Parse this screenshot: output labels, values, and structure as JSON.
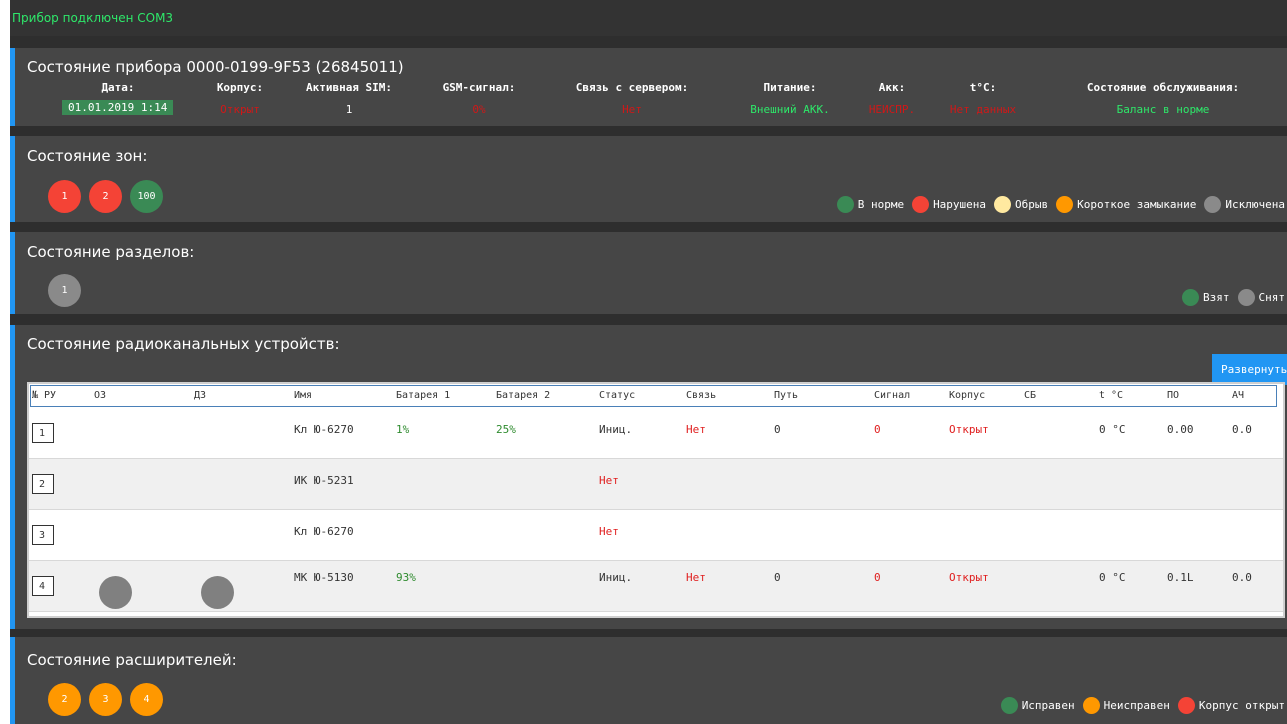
{
  "status_bar": {
    "text": "Прибор подключен COM3"
  },
  "device": {
    "title": "Состояние прибора 0000-0199-9F53 (26845011)",
    "fields": [
      {
        "label": "Дата:",
        "value": "01.01.2019 1:14",
        "color": "#ffffff",
        "boxed": true
      },
      {
        "label": "Корпус:",
        "value": "Открыт",
        "color": "#d01818"
      },
      {
        "label": "Активная SIM:",
        "value": "1",
        "color": "#ffffff"
      },
      {
        "label": "GSM-сигнал:",
        "value": "0%",
        "color": "#d01818"
      },
      {
        "label": "Связь с сервером:",
        "value": "Нет",
        "color": "#d01818"
      },
      {
        "label": "Питание:",
        "value": "Внешний АКК.",
        "color": "#2ee86a"
      },
      {
        "label": "Акк:",
        "value": "НЕИСПР.",
        "color": "#d01818"
      },
      {
        "label": "t°C:",
        "value": "Нет данных",
        "color": "#d01818"
      },
      {
        "label": "Состояние обслуживания:",
        "value": "Баланс в норме",
        "color": "#2ee86a"
      }
    ]
  },
  "zones": {
    "title": "Состояние зон:",
    "items": [
      {
        "label": "1",
        "state": "red"
      },
      {
        "label": "2",
        "state": "red"
      },
      {
        "label": "100",
        "state": "green"
      }
    ],
    "legend": [
      {
        "label": "В норме",
        "color": "#3a8a55"
      },
      {
        "label": "Нарушена",
        "color": "#f44336"
      },
      {
        "label": "Обрыв",
        "color": "#ffe9a0"
      },
      {
        "label": "Короткое замыкание",
        "color": "#ff9800"
      },
      {
        "label": "Исключена",
        "color": "#8a8a8a"
      }
    ]
  },
  "partitions": {
    "title": "Состояние разделов:",
    "items": [
      {
        "label": "1",
        "state": "grey"
      }
    ],
    "legend": [
      {
        "label": "Взят",
        "color": "#3a8a55"
      },
      {
        "label": "Снят",
        "color": "#8a8a8a"
      }
    ]
  },
  "radio": {
    "title": "Состояние радиоканальных устройств:",
    "expand_label": "Развернуть",
    "columns": [
      "№ РУ",
      "ОЗ",
      "ДЗ",
      "Имя",
      "Батарея 1",
      "Батарея 2",
      "Статус",
      "Связь",
      "Путь",
      "Сигнал",
      "Корпус",
      "СБ",
      "t °C",
      "ПО",
      "АЧ"
    ],
    "rows": [
      {
        "num": "1",
        "oz": false,
        "dz": false,
        "name": "Кл Ю-6270",
        "bat1": "1%",
        "bat2": "25%",
        "status": "Иниц.",
        "status_red": false,
        "link": "Нет",
        "path": "0",
        "signal": "0",
        "case": "Открыт",
        "sb": "",
        "temp": "0 °C",
        "fw": "0.00",
        "ach": "0.0"
      },
      {
        "num": "2",
        "oz": false,
        "dz": false,
        "name": "ИК Ю-5231",
        "bat1": "",
        "bat2": "",
        "status": "Нет",
        "status_red": true,
        "link": "",
        "path": "",
        "signal": "",
        "case": "",
        "sb": "",
        "temp": "",
        "fw": "",
        "ach": ""
      },
      {
        "num": "3",
        "oz": false,
        "dz": false,
        "name": "Кл Ю-6270",
        "bat1": "",
        "bat2": "",
        "status": "Нет",
        "status_red": true,
        "link": "",
        "path": "",
        "signal": "",
        "case": "",
        "sb": "",
        "temp": "",
        "fw": "",
        "ach": ""
      },
      {
        "num": "4",
        "oz": true,
        "dz": true,
        "name": "МК Ю-5130",
        "bat1": "93%",
        "bat2": "",
        "status": "Иниц.",
        "status_red": false,
        "link": "Нет",
        "path": "0",
        "signal": "0",
        "case": "Открыт",
        "sb": "",
        "temp": "0 °C",
        "fw": "0.1L",
        "ach": "0.0"
      }
    ]
  },
  "expanders": {
    "title": "Состояние расширителей:",
    "items": [
      {
        "label": "2",
        "state": "orange"
      },
      {
        "label": "3",
        "state": "orange"
      },
      {
        "label": "4",
        "state": "orange"
      }
    ],
    "legend": [
      {
        "label": "Исправен",
        "color": "#3a8a55"
      },
      {
        "label": "Неисправен",
        "color": "#ff9800"
      },
      {
        "label": "Корпус открыт",
        "color": "#f44336"
      }
    ]
  },
  "colors": {
    "accent": "#2196f3",
    "ok": "#2ee86a",
    "alarm": "#d01818",
    "table_green": "#2e8b2e",
    "table_red": "#e02020"
  }
}
